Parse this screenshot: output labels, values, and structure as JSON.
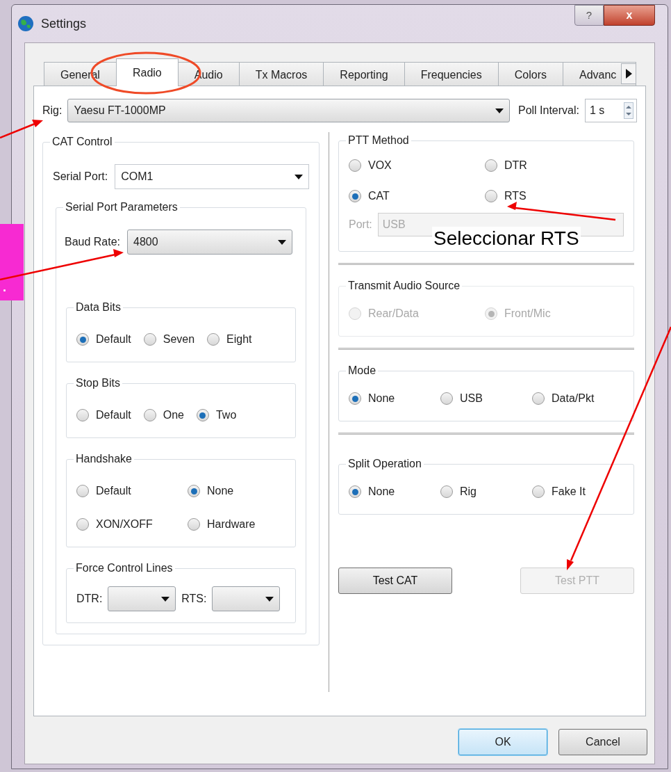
{
  "window": {
    "title": "Settings",
    "help_button": "?",
    "close_button": "x"
  },
  "tabs": [
    {
      "label": "General",
      "selected": false
    },
    {
      "label": "Radio",
      "selected": true
    },
    {
      "label": "Audio",
      "selected": false
    },
    {
      "label": "Tx Macros",
      "selected": false
    },
    {
      "label": "Reporting",
      "selected": false
    },
    {
      "label": "Frequencies",
      "selected": false
    },
    {
      "label": "Colors",
      "selected": false
    },
    {
      "label": "Advanc",
      "selected": false
    }
  ],
  "rig": {
    "label": "Rig:",
    "value": "Yaesu FT-1000MP"
  },
  "poll_interval": {
    "label": "Poll Interval:",
    "value": "1 s"
  },
  "cat_control": {
    "title": "CAT Control",
    "serial_port": {
      "label": "Serial Port:",
      "value": "COM1"
    },
    "serial_port_parameters": {
      "title": "Serial Port Parameters",
      "baud_rate": {
        "label": "Baud Rate:",
        "value": "4800"
      },
      "groups": [
        {
          "title": "Data Bits",
          "options": [
            {
              "label": "Default",
              "selected": true
            },
            {
              "label": "Seven",
              "selected": false
            },
            {
              "label": "Eight",
              "selected": false
            }
          ]
        },
        {
          "title": "Stop Bits",
          "options": [
            {
              "label": "Default",
              "selected": false
            },
            {
              "label": "One",
              "selected": false
            },
            {
              "label": "Two",
              "selected": true
            }
          ]
        },
        {
          "title": "Handshake",
          "options": [
            {
              "label": "Default",
              "selected": false
            },
            {
              "label": "None",
              "selected": true
            },
            {
              "label": "XON/XOFF",
              "selected": false
            },
            {
              "label": "Hardware",
              "selected": false
            }
          ]
        }
      ],
      "force_control_lines": {
        "title": "Force Control Lines",
        "fields": [
          {
            "label": "DTR:"
          },
          {
            "label": "RTS:"
          }
        ]
      }
    }
  },
  "ptt_method": {
    "title": "PTT Method",
    "options": [
      {
        "label": "VOX",
        "selected": false
      },
      {
        "label": "DTR",
        "selected": false
      },
      {
        "label": "CAT",
        "selected": true
      },
      {
        "label": "RTS",
        "selected": false
      }
    ],
    "port": {
      "label": "Port:",
      "value": "USB",
      "disabled": true
    }
  },
  "right_groups": [
    {
      "title": "Transmit Audio Source",
      "disabled": true,
      "options": [
        {
          "label": "Rear/Data",
          "selected": false
        },
        {
          "label": "Front/Mic",
          "selected": true
        }
      ]
    },
    {
      "title": "Mode",
      "disabled": false,
      "options": [
        {
          "label": "None",
          "selected": true
        },
        {
          "label": "USB",
          "selected": false
        },
        {
          "label": "Data/Pkt",
          "selected": false
        }
      ]
    },
    {
      "title": "Split Operation",
      "disabled": false,
      "options": [
        {
          "label": "None",
          "selected": true
        },
        {
          "label": "Rig",
          "selected": false
        },
        {
          "label": "Fake It",
          "selected": false
        }
      ]
    }
  ],
  "test_buttons": [
    {
      "label": "Test CAT",
      "disabled": false
    },
    {
      "label": "Test PTT",
      "disabled": true
    }
  ],
  "footer_buttons": [
    {
      "label": "OK",
      "default": true
    },
    {
      "label": "Cancel",
      "default": false
    }
  ],
  "annotations": {
    "callout": "Seleccionar RTS",
    "side_note": "."
  }
}
